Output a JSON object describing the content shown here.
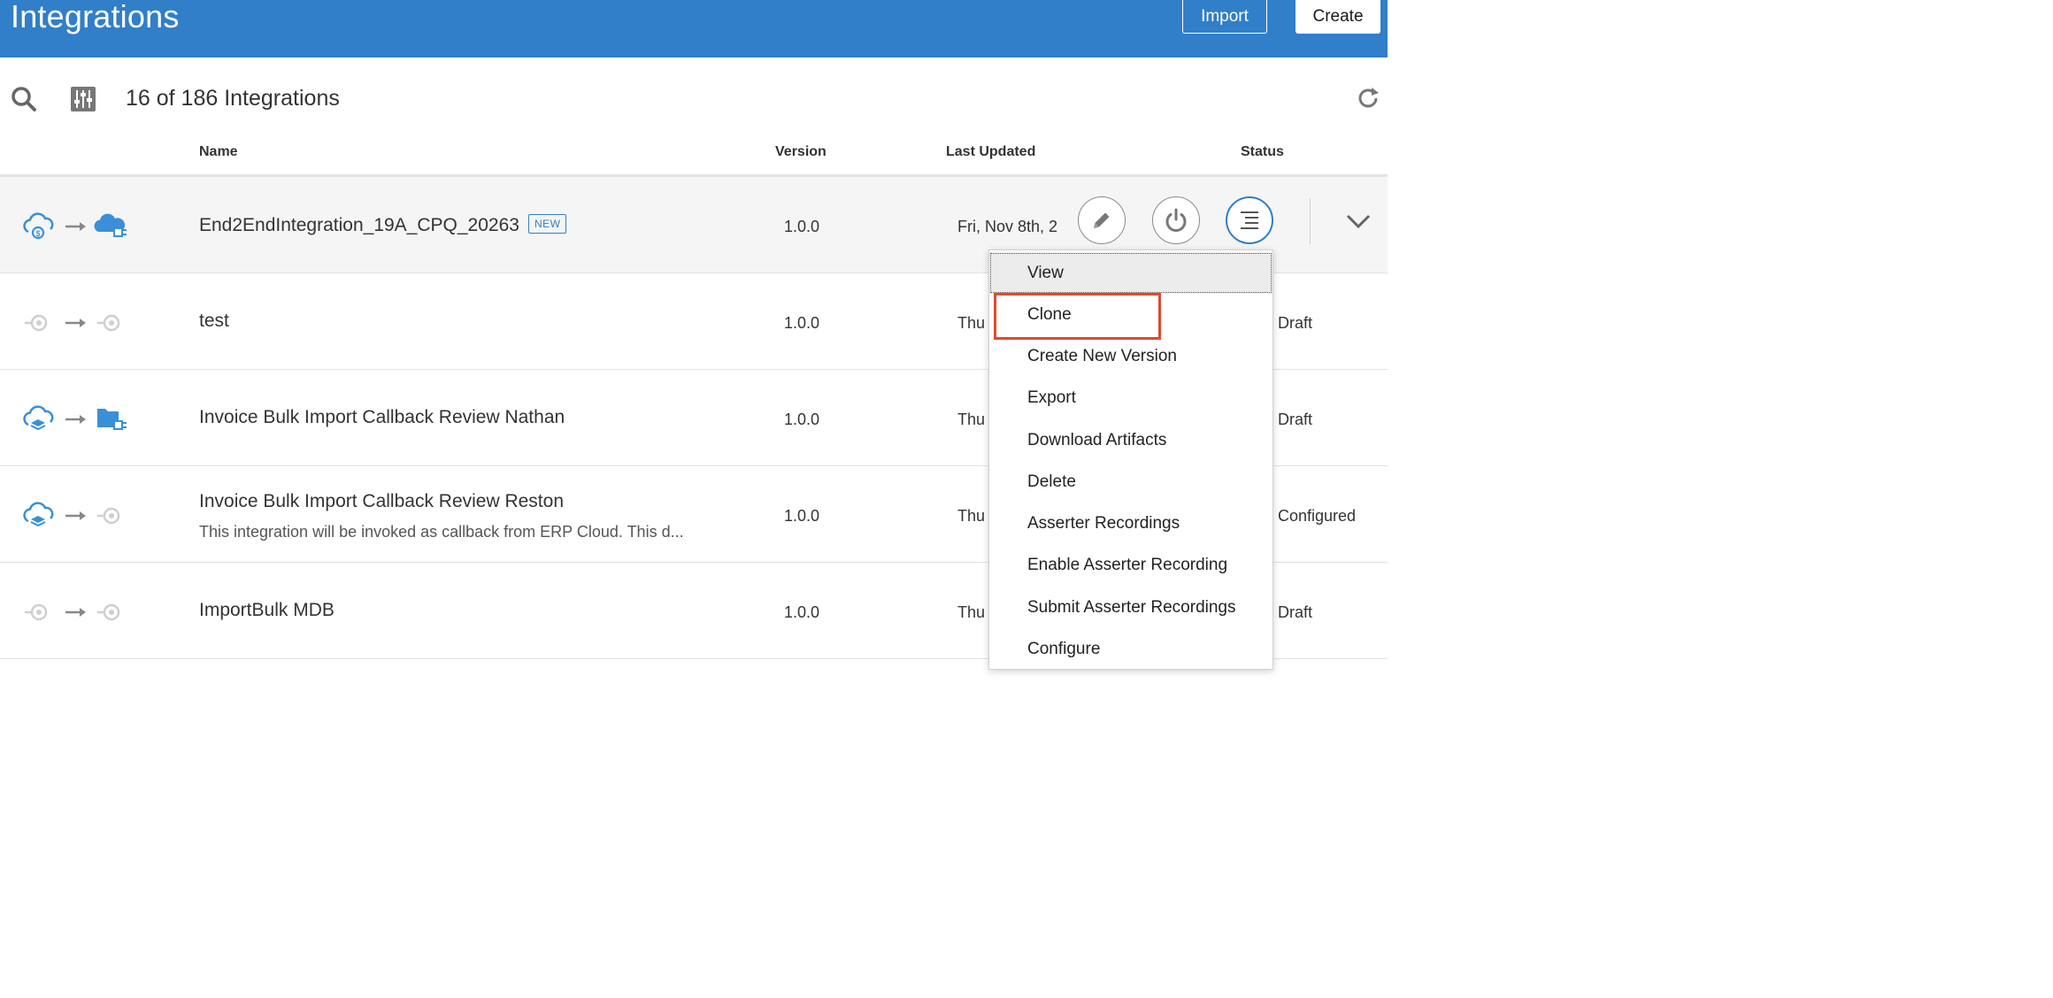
{
  "header": {
    "title": "Integrations",
    "import_label": "Import",
    "create_label": "Create"
  },
  "toolbar": {
    "count_text": "16 of 186 Integrations"
  },
  "columns": {
    "name": "Name",
    "version": "Version",
    "last_updated": "Last Updated",
    "status": "Status"
  },
  "rows": [
    {
      "name": "End2EndIntegration_19A_CPQ_20263",
      "badge": "NEW",
      "version": "1.0.0",
      "last_updated": "Fri, Nov 8th, 2",
      "status": "",
      "source_icon": "cloud-dollar-icon",
      "target_icon": "cloud-plug-icon"
    },
    {
      "name": "test",
      "version": "1.0.0",
      "last_updated": "Thu",
      "status": "Draft",
      "source_icon": "connector-placeholder-icon",
      "target_icon": "connector-placeholder-icon"
    },
    {
      "name": "Invoice Bulk Import Callback Review Nathan",
      "version": "1.0.0",
      "last_updated": "Thu",
      "status": "Draft",
      "source_icon": "cloud-layers-icon",
      "target_icon": "folder-plug-icon"
    },
    {
      "name": "Invoice Bulk Import Callback Review Reston",
      "description": "This integration will be invoked as callback from ERP Cloud. This d...",
      "version": "1.0.0",
      "last_updated": "Thu",
      "status": "Configured",
      "source_icon": "cloud-layers-icon",
      "target_icon": "connector-placeholder-icon"
    },
    {
      "name": "ImportBulk MDB",
      "version": "1.0.0",
      "last_updated": "Thu",
      "status": "Draft",
      "source_icon": "connector-placeholder-icon",
      "target_icon": "connector-placeholder-icon"
    }
  ],
  "actions_menu": {
    "items": [
      "View",
      "Clone",
      "Create New Version",
      "Export",
      "Download Artifacts",
      "Delete",
      "Asserter Recordings",
      "Enable Asserter Recording",
      "Submit Asserter Recordings",
      "Configure"
    ],
    "focused_item": "View",
    "highlighted_item": "Clone"
  },
  "colors": {
    "header_bg": "#317ec9",
    "icon_blue": "#3a8fd6",
    "icon_inactive": "#cfcfcf",
    "highlight_red": "#e04a2f"
  }
}
